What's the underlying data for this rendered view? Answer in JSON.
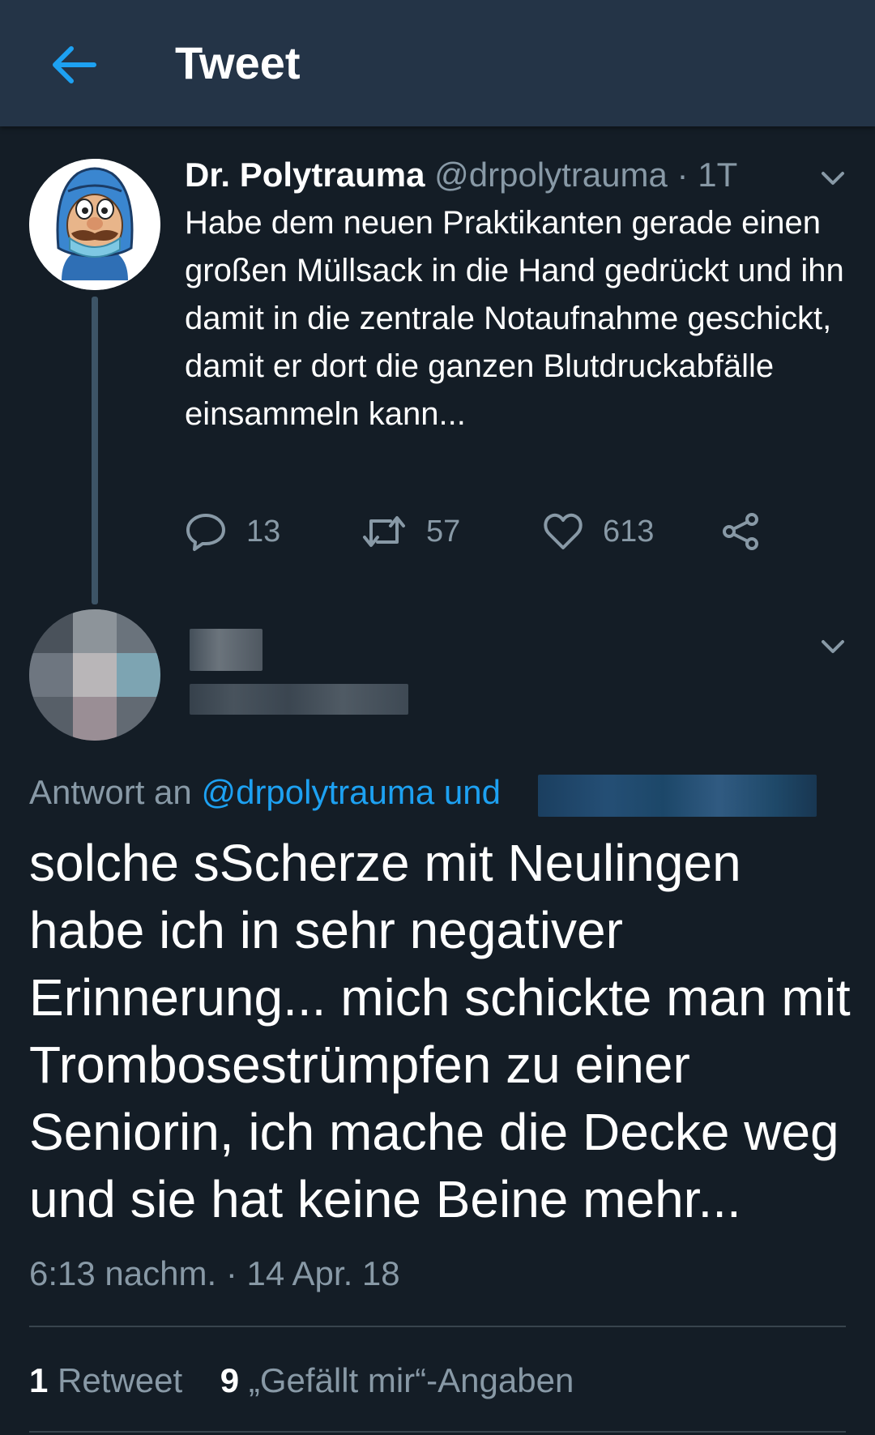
{
  "header": {
    "title": "Tweet",
    "back_icon": "arrow-left-icon",
    "accent": "#1da1f2",
    "background": "#243447"
  },
  "tweet": {
    "author_name": "Dr. Polytrauma",
    "handle": "@drpolytrauma",
    "separator": "·",
    "age": "1T",
    "text": "Habe dem neuen Praktikanten gerade einen großen Müllsack in die Hand gedrückt und ihn damit in die zentrale Notaufnahme geschickt, damit er dort die ganzen Blutdruckabfälle einsammeln kann...",
    "replies": "13",
    "retweets": "57",
    "likes": "613"
  },
  "reply": {
    "reply_to_label": "Antwort an",
    "reply_to_mention": "@drpolytrauma und",
    "text": "solche sScherze mit Neulingen habe ich in sehr negativer Erinnerung... mich schickte man mit Trombosestrümpfen zu einer Seniorin, ich mache die Decke weg und sie hat keine Beine mehr...",
    "timestamp": "6:13 nachm. · 14 Apr. 18",
    "retweet_count": "1",
    "retweet_label": "Retweet",
    "like_count": "9",
    "like_label": "„Gefällt mir“-Angaben"
  },
  "colors": {
    "background": "#141d26",
    "secondary_text": "#8899a6",
    "divider": "#38444d"
  }
}
